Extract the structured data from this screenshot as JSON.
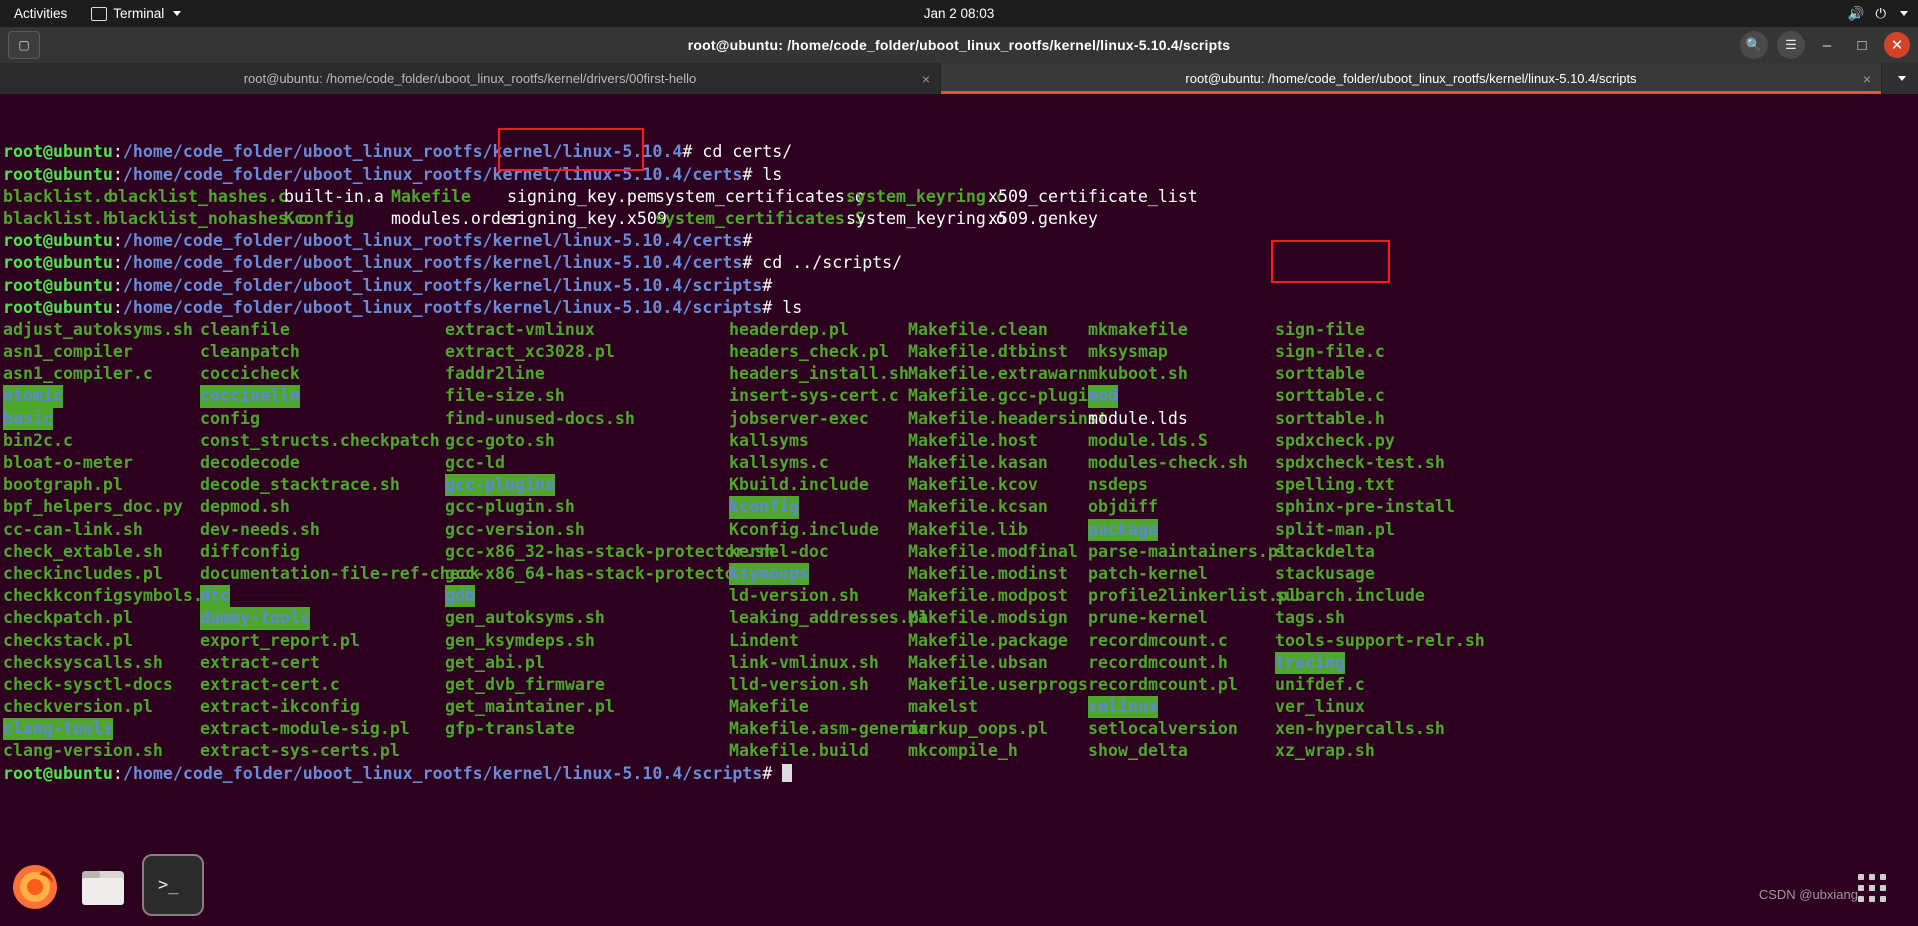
{
  "topbar": {
    "activities": "Activities",
    "app_name": "Terminal",
    "app_icon": "terminal-icon",
    "clock": "Jan 2  08:03",
    "volume_icon": "volume-icon",
    "power_icon": "power-icon",
    "chevron_icon": "chevron-down-icon"
  },
  "window": {
    "title": "root@ubuntu: /home/code_folder/uboot_linux_rootfs/kernel/linux-5.10.4/scripts",
    "new_tab_icon": "new-tab-icon",
    "search_icon": "search-icon",
    "menu_icon": "hamburger-menu-icon",
    "minimize_label": "–",
    "maximize_label": "□",
    "close_label": "✕"
  },
  "tabs": [
    {
      "label": "root@ubuntu: /home/code_folder/uboot_linux_rootfs/kernel/drivers/00first-hello",
      "active": false,
      "close_label": "×"
    },
    {
      "label": "root@ubuntu: /home/code_folder/uboot_linux_rootfs/kernel/linux-5.10.4/scripts",
      "active": true,
      "close_label": "×"
    }
  ],
  "tab_list_icon": "chevron-down-icon",
  "terminal": {
    "user": "root@ubuntu",
    "colon": ":",
    "prompt_char": "# ",
    "history": [
      {
        "path": "/home/code_folder/uboot_linux_rootfs/kernel/linux-5.10.4",
        "command": "cd certs/"
      },
      {
        "path": "/home/code_folder/uboot_linux_rootfs/kernel/linux-5.10.4/certs",
        "command": "ls"
      }
    ],
    "certs_listing": [
      [
        {
          "n": "blacklist.c",
          "t": "exec"
        },
        {
          "n": "blacklist_hashes.c",
          "t": "exec"
        },
        {
          "n": "built-in.a",
          "t": "plain"
        },
        {
          "n": "Makefile",
          "t": "exec"
        },
        {
          "n": "signing_key.pem",
          "t": "plain"
        },
        {
          "n": "system_certificates.o",
          "t": "plain"
        },
        {
          "n": "system_keyring.c",
          "t": "exec"
        },
        {
          "n": "x509_certificate_list",
          "t": "plain"
        }
      ],
      [
        {
          "n": "blacklist.h",
          "t": "exec"
        },
        {
          "n": "blacklist_nohashes.c",
          "t": "exec"
        },
        {
          "n": "Kconfig",
          "t": "exec"
        },
        {
          "n": "modules.order",
          "t": "plain"
        },
        {
          "n": "signing_key.x509",
          "t": "plain"
        },
        {
          "n": "system_certificates.S",
          "t": "exec"
        },
        {
          "n": "system_keyring.o",
          "t": "plain"
        },
        {
          "n": "x509.genkey",
          "t": "plain"
        }
      ]
    ],
    "mid_prompts": [
      {
        "path": "/home/code_folder/uboot_linux_rootfs/kernel/linux-5.10.4/certs",
        "command": ""
      },
      {
        "path": "/home/code_folder/uboot_linux_rootfs/kernel/linux-5.10.4/certs",
        "command": "cd ../scripts/"
      },
      {
        "path": "/home/code_folder/uboot_linux_rootfs/kernel/linux-5.10.4/scripts",
        "command": ""
      },
      {
        "path": "/home/code_folder/uboot_linux_rootfs/kernel/linux-5.10.4/scripts",
        "command": "ls"
      }
    ],
    "final_prompt": {
      "path": "/home/code_folder/uboot_linux_rootfs/kernel/linux-5.10.4/scripts",
      "command": ""
    },
    "scripts_columns": [
      [
        {
          "n": "adjust_autoksyms.sh",
          "t": "exec"
        },
        {
          "n": "asn1_compiler",
          "t": "exec"
        },
        {
          "n": "asn1_compiler.c",
          "t": "exec"
        },
        {
          "n": "atomic",
          "t": "dir"
        },
        {
          "n": "basic",
          "t": "dir"
        },
        {
          "n": "bin2c.c",
          "t": "exec"
        },
        {
          "n": "bloat-o-meter",
          "t": "exec"
        },
        {
          "n": "bootgraph.pl",
          "t": "exec"
        },
        {
          "n": "bpf_helpers_doc.py",
          "t": "exec"
        },
        {
          "n": "cc-can-link.sh",
          "t": "exec"
        },
        {
          "n": "check_extable.sh",
          "t": "exec"
        },
        {
          "n": "checkincludes.pl",
          "t": "exec"
        },
        {
          "n": "checkkconfigsymbols.py",
          "t": "exec"
        },
        {
          "n": "checkpatch.pl",
          "t": "exec"
        },
        {
          "n": "checkstack.pl",
          "t": "exec"
        },
        {
          "n": "checksyscalls.sh",
          "t": "exec"
        },
        {
          "n": "check-sysctl-docs",
          "t": "exec"
        },
        {
          "n": "checkversion.pl",
          "t": "exec"
        },
        {
          "n": "clang-tools",
          "t": "dir"
        },
        {
          "n": "clang-version.sh",
          "t": "exec"
        }
      ],
      [
        {
          "n": "cleanfile",
          "t": "exec"
        },
        {
          "n": "cleanpatch",
          "t": "exec"
        },
        {
          "n": "coccicheck",
          "t": "exec"
        },
        {
          "n": "coccinelle",
          "t": "dir"
        },
        {
          "n": "config",
          "t": "exec"
        },
        {
          "n": "const_structs.checkpatch",
          "t": "exec"
        },
        {
          "n": "decodecode",
          "t": "exec"
        },
        {
          "n": "decode_stacktrace.sh",
          "t": "exec"
        },
        {
          "n": "depmod.sh",
          "t": "exec"
        },
        {
          "n": "dev-needs.sh",
          "t": "exec"
        },
        {
          "n": "diffconfig",
          "t": "exec"
        },
        {
          "n": "documentation-file-ref-check",
          "t": "exec"
        },
        {
          "n": "dtc",
          "t": "dir"
        },
        {
          "n": "dummy-tools",
          "t": "dir"
        },
        {
          "n": "export_report.pl",
          "t": "exec"
        },
        {
          "n": "extract-cert",
          "t": "exec"
        },
        {
          "n": "extract-cert.c",
          "t": "exec"
        },
        {
          "n": "extract-ikconfig",
          "t": "exec"
        },
        {
          "n": "extract-module-sig.pl",
          "t": "exec"
        },
        {
          "n": "extract-sys-certs.pl",
          "t": "exec"
        }
      ],
      [
        {
          "n": "extract-vmlinux",
          "t": "exec"
        },
        {
          "n": "extract_xc3028.pl",
          "t": "exec"
        },
        {
          "n": "faddr2line",
          "t": "exec"
        },
        {
          "n": "file-size.sh",
          "t": "exec"
        },
        {
          "n": "find-unused-docs.sh",
          "t": "exec"
        },
        {
          "n": "gcc-goto.sh",
          "t": "exec"
        },
        {
          "n": "gcc-ld",
          "t": "exec"
        },
        {
          "n": "gcc-plugins",
          "t": "dir"
        },
        {
          "n": "gcc-plugin.sh",
          "t": "exec"
        },
        {
          "n": "gcc-version.sh",
          "t": "exec"
        },
        {
          "n": "gcc-x86_32-has-stack-protector.sh",
          "t": "exec"
        },
        {
          "n": "gcc-x86_64-has-stack-protector.sh",
          "t": "exec"
        },
        {
          "n": "gdb",
          "t": "dir"
        },
        {
          "n": "gen_autoksyms.sh",
          "t": "exec"
        },
        {
          "n": "gen_ksymdeps.sh",
          "t": "exec"
        },
        {
          "n": "get_abi.pl",
          "t": "exec"
        },
        {
          "n": "get_dvb_firmware",
          "t": "exec"
        },
        {
          "n": "get_maintainer.pl",
          "t": "exec"
        },
        {
          "n": "gfp-translate",
          "t": "exec"
        }
      ],
      [
        {
          "n": "headerdep.pl",
          "t": "exec"
        },
        {
          "n": "headers_check.pl",
          "t": "exec"
        },
        {
          "n": "headers_install.sh",
          "t": "exec"
        },
        {
          "n": "insert-sys-cert.c",
          "t": "exec"
        },
        {
          "n": "jobserver-exec",
          "t": "exec"
        },
        {
          "n": "kallsyms",
          "t": "exec"
        },
        {
          "n": "kallsyms.c",
          "t": "exec"
        },
        {
          "n": "Kbuild.include",
          "t": "exec"
        },
        {
          "n": "kconfig",
          "t": "dir"
        },
        {
          "n": "Kconfig.include",
          "t": "exec"
        },
        {
          "n": "kernel-doc",
          "t": "exec"
        },
        {
          "n": "ksymoops",
          "t": "dir"
        },
        {
          "n": "ld-version.sh",
          "t": "exec"
        },
        {
          "n": "leaking_addresses.pl",
          "t": "exec"
        },
        {
          "n": "Lindent",
          "t": "exec"
        },
        {
          "n": "link-vmlinux.sh",
          "t": "exec"
        },
        {
          "n": "lld-version.sh",
          "t": "exec"
        },
        {
          "n": "Makefile",
          "t": "exec"
        },
        {
          "n": "Makefile.asm-generic",
          "t": "exec"
        },
        {
          "n": "Makefile.build",
          "t": "exec"
        }
      ],
      [
        {
          "n": "Makefile.clean",
          "t": "exec"
        },
        {
          "n": "Makefile.dtbinst",
          "t": "exec"
        },
        {
          "n": "Makefile.extrawarn",
          "t": "exec"
        },
        {
          "n": "Makefile.gcc-plugins",
          "t": "exec"
        },
        {
          "n": "Makefile.headersinst",
          "t": "exec"
        },
        {
          "n": "Makefile.host",
          "t": "exec"
        },
        {
          "n": "Makefile.kasan",
          "t": "exec"
        },
        {
          "n": "Makefile.kcov",
          "t": "exec"
        },
        {
          "n": "Makefile.kcsan",
          "t": "exec"
        },
        {
          "n": "Makefile.lib",
          "t": "exec"
        },
        {
          "n": "Makefile.modfinal",
          "t": "exec"
        },
        {
          "n": "Makefile.modinst",
          "t": "exec"
        },
        {
          "n": "Makefile.modpost",
          "t": "exec"
        },
        {
          "n": "Makefile.modsign",
          "t": "exec"
        },
        {
          "n": "Makefile.package",
          "t": "exec"
        },
        {
          "n": "Makefile.ubsan",
          "t": "exec"
        },
        {
          "n": "Makefile.userprogs",
          "t": "exec"
        },
        {
          "n": "makelst",
          "t": "exec"
        },
        {
          "n": "markup_oops.pl",
          "t": "exec"
        },
        {
          "n": "mkcompile_h",
          "t": "exec"
        }
      ],
      [
        {
          "n": "mkmakefile",
          "t": "exec"
        },
        {
          "n": "mksysmap",
          "t": "exec"
        },
        {
          "n": "mkuboot.sh",
          "t": "exec"
        },
        {
          "n": "mod",
          "t": "dir"
        },
        {
          "n": "module.lds",
          "t": "plain"
        },
        {
          "n": "module.lds.S",
          "t": "exec"
        },
        {
          "n": "modules-check.sh",
          "t": "exec"
        },
        {
          "n": "nsdeps",
          "t": "exec"
        },
        {
          "n": "objdiff",
          "t": "exec"
        },
        {
          "n": "package",
          "t": "dir"
        },
        {
          "n": "parse-maintainers.pl",
          "t": "exec"
        },
        {
          "n": "patch-kernel",
          "t": "exec"
        },
        {
          "n": "profile2linkerlist.pl",
          "t": "exec"
        },
        {
          "n": "prune-kernel",
          "t": "exec"
        },
        {
          "n": "recordmcount.c",
          "t": "exec"
        },
        {
          "n": "recordmcount.h",
          "t": "exec"
        },
        {
          "n": "recordmcount.pl",
          "t": "exec"
        },
        {
          "n": "selinux",
          "t": "dir"
        },
        {
          "n": "setlocalversion",
          "t": "exec"
        },
        {
          "n": "show_delta",
          "t": "exec"
        }
      ],
      [
        {
          "n": "sign-file",
          "t": "exec"
        },
        {
          "n": "sign-file.c",
          "t": "exec"
        },
        {
          "n": "sorttable",
          "t": "exec"
        },
        {
          "n": "sorttable.c",
          "t": "exec"
        },
        {
          "n": "sorttable.h",
          "t": "exec"
        },
        {
          "n": "spdxcheck.py",
          "t": "exec"
        },
        {
          "n": "spdxcheck-test.sh",
          "t": "exec"
        },
        {
          "n": "spelling.txt",
          "t": "exec"
        },
        {
          "n": "sphinx-pre-install",
          "t": "exec"
        },
        {
          "n": "split-man.pl",
          "t": "exec"
        },
        {
          "n": "stackdelta",
          "t": "exec"
        },
        {
          "n": "stackusage",
          "t": "exec"
        },
        {
          "n": "subarch.include",
          "t": "exec"
        },
        {
          "n": "tags.sh",
          "t": "exec"
        },
        {
          "n": "tools-support-relr.sh",
          "t": "exec"
        },
        {
          "n": "tracing",
          "t": "dir"
        },
        {
          "n": "unifdef.c",
          "t": "exec"
        },
        {
          "n": "ver_linux",
          "t": "exec"
        },
        {
          "n": "xen-hypercalls.sh",
          "t": "exec"
        },
        {
          "n": "xz_wrap.sh",
          "t": "exec"
        }
      ]
    ],
    "annotations": [
      {
        "name": "signing-key-highlight",
        "color": "#ff1a1a"
      },
      {
        "name": "sign-file-highlight",
        "color": "#ff1a1a"
      }
    ]
  },
  "dock": {
    "items": [
      {
        "name": "firefox-icon",
        "label": "Firefox"
      },
      {
        "name": "files-icon",
        "label": "Files"
      },
      {
        "name": "terminal-icon",
        "label": "Terminal"
      }
    ],
    "show_apps": "show-applications-icon"
  },
  "watermark": "CSDN @ubxiang",
  "colors": {
    "terminal_bg": "#2c001e",
    "dir_bg": "#4ea72a",
    "dir_fg": "#5f87d7",
    "exec_fg": "#4ea72a",
    "user_fg": "#4ee44e",
    "path_fg": "#6a8bd6",
    "accent": "#e95420",
    "annotation": "#ff1a1a"
  }
}
